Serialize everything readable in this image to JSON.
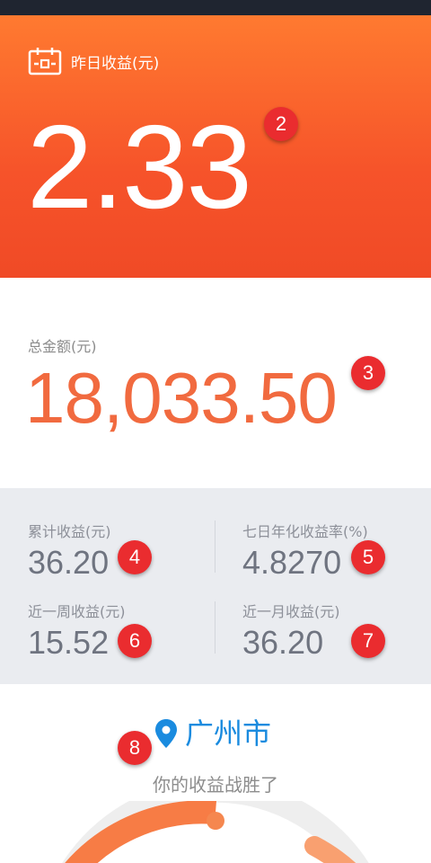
{
  "hero": {
    "label": "昨日收益(元)",
    "value": "2.33",
    "badge": "2"
  },
  "total": {
    "label": "总金额(元)",
    "value": "18,033.50",
    "badge": "3"
  },
  "stats": [
    {
      "label": "累计收益(元)",
      "value": "36.20",
      "badge": "4"
    },
    {
      "label": "七日年化收益率(%)",
      "value": "4.8270",
      "badge": "5"
    },
    {
      "label": "近一周收益(元)",
      "value": "15.52",
      "badge": "6"
    },
    {
      "label": "近一月收益(元)",
      "value": "36.20",
      "badge": "7"
    }
  ],
  "ranking": {
    "city": "广州市",
    "text": "你的收益战胜了",
    "badge": "8"
  },
  "colors": {
    "accent": "#f6532a",
    "total_value": "#f16a3f",
    "city": "#1a8bdf",
    "badge": "#ea2c2f"
  },
  "icons": [
    "calendar-icon",
    "location-pin-icon"
  ]
}
